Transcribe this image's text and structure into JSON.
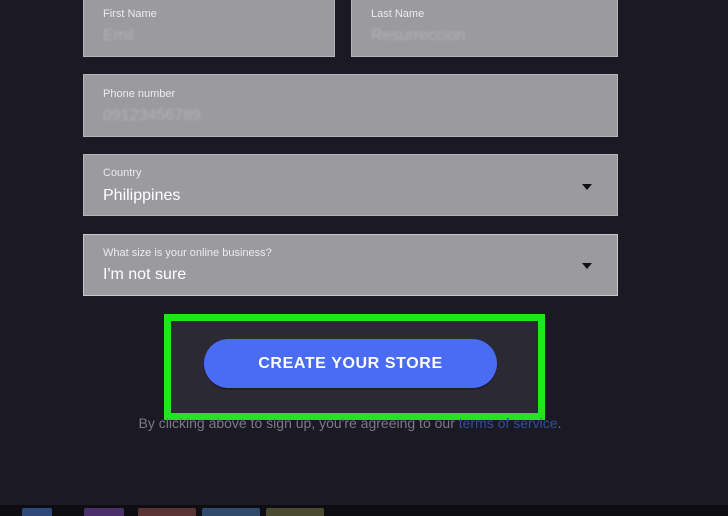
{
  "form": {
    "first_name": {
      "label": "First Name",
      "placeholder": "Emil"
    },
    "last_name": {
      "label": "Last Name",
      "placeholder": "Resurreccion"
    },
    "phone": {
      "label": "Phone number",
      "placeholder": "09123456789"
    },
    "country": {
      "label": "Country",
      "value": "Philippines",
      "icon": "chevron-down-icon"
    },
    "business_size": {
      "label": "What size is your online business?",
      "value": "I'm not sure",
      "icon": "chevron-down-icon"
    }
  },
  "cta": {
    "label": "CREATE YOUR STORE"
  },
  "terms": {
    "prefix": "By clicking above to sign up, you're agreeing to our ",
    "link": "terms of service",
    "suffix": "."
  },
  "colors": {
    "background": "#1b1a24",
    "field": "#9a9a9f",
    "button": "#4a6cf4",
    "highlight": "#22e51f",
    "link": "#2e4d9a"
  }
}
